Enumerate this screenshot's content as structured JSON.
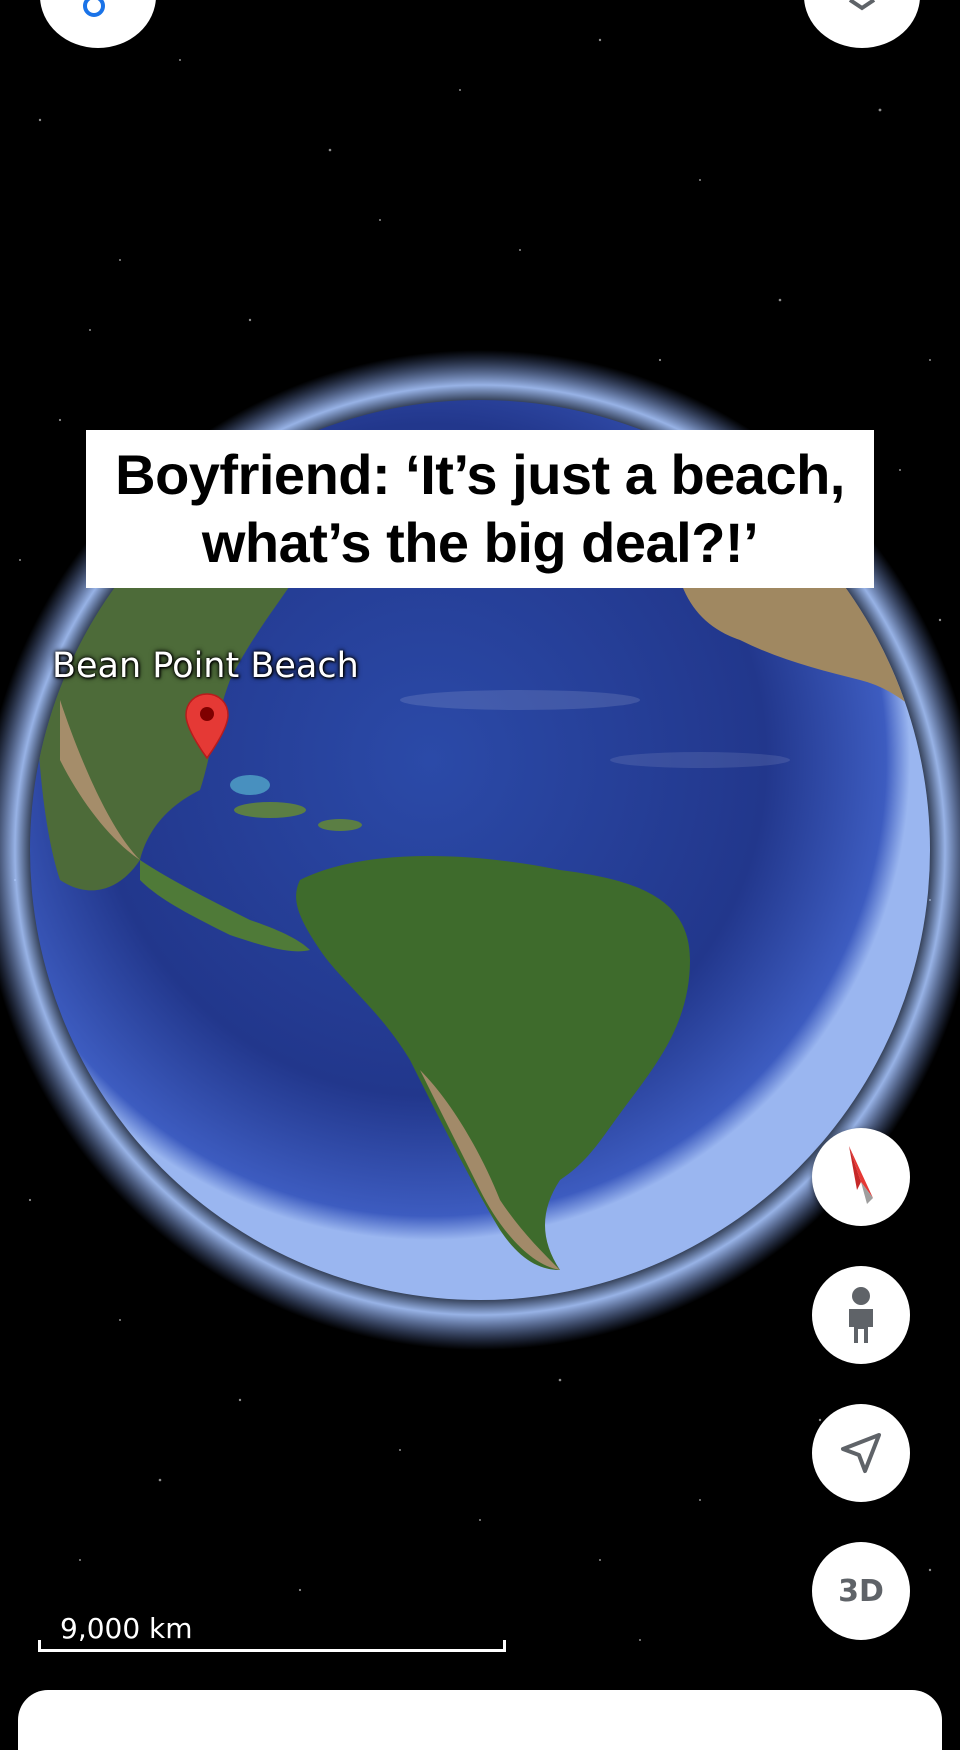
{
  "caption": {
    "line1": "Boyfriend: ‘It’s just a beach,",
    "line2": "what’s the big deal?!’"
  },
  "map": {
    "place_label": "Bean Point Beach",
    "scale_label": "9,000 km"
  },
  "controls": {
    "three_d_label": "3D"
  },
  "icons": {
    "top_left": "search-icon",
    "top_right": "layers-icon",
    "compass": "compass-icon",
    "street_view": "pegman-icon",
    "my_location": "my-location-icon",
    "pin": "map-pin-icon"
  },
  "colors": {
    "ocean": "#24409a",
    "land_green": "#3e6b2c",
    "pin": "#e53935",
    "space": "#000000"
  }
}
